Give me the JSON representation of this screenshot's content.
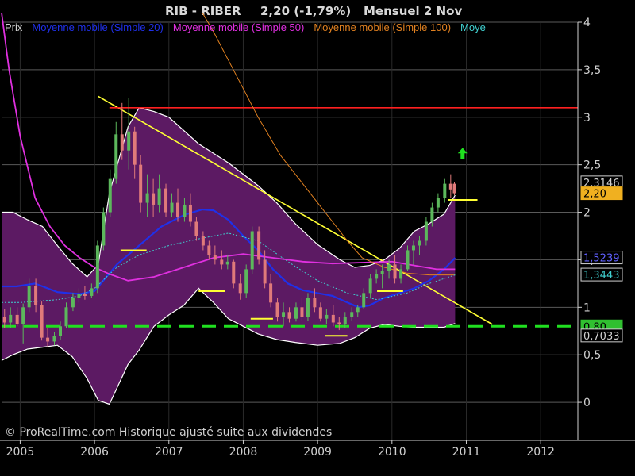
{
  "chart_data": {
    "type": "candlestick",
    "title": {
      "symbol": "RIB - RIBER",
      "change": "2,20 (-1,79%)",
      "period": "Mensuel  2 Nov"
    },
    "legend": [
      {
        "name": "Prix",
        "color": "#d0d0d0"
      },
      {
        "name": "Moyenne mobile (Simple 20)",
        "color": "#2030e8"
      },
      {
        "name": "Moyenne mobile (Simple 50)",
        "color": "#e030e0"
      },
      {
        "name": "Moyenne mobile (Simple 100)",
        "color": "#e08020"
      },
      {
        "name": "Moye",
        "color": "#40d0d0"
      }
    ],
    "footer": "© ProRealTime.com Historique ajusté suite aux dividendes",
    "ylim": [
      -0.4,
      4.0
    ],
    "xlim": [
      2004.75,
      2012.5
    ],
    "y_ticks": [
      {
        "value": 4,
        "label": "4"
      },
      {
        "value": 3.5,
        "label": "3,5"
      },
      {
        "value": 3,
        "label": "3"
      },
      {
        "value": 2.5,
        "label": "2,5"
      },
      {
        "value": 2,
        "label": "2"
      },
      {
        "value": 1.5,
        "label": "1,5"
      },
      {
        "value": 1,
        "label": "1"
      },
      {
        "value": 0.5,
        "label": "0,5"
      },
      {
        "value": 0,
        "label": "0"
      }
    ],
    "x_ticks": [
      {
        "value": 2005,
        "label": "2005"
      },
      {
        "value": 2006,
        "label": "2006"
      },
      {
        "value": 2007,
        "label": "2007"
      },
      {
        "value": 2008,
        "label": "2008"
      },
      {
        "value": 2009,
        "label": "2009"
      },
      {
        "value": 2010,
        "label": "2010"
      },
      {
        "value": 2011,
        "label": "2011"
      },
      {
        "value": 2012,
        "label": "2012"
      }
    ],
    "candles": [
      [
        2004.79,
        0.9,
        0.98,
        0.78,
        0.84
      ],
      [
        2004.87,
        0.84,
        1.0,
        0.78,
        0.92
      ],
      [
        2004.96,
        0.92,
        1.0,
        0.8,
        0.82
      ],
      [
        2005.04,
        0.82,
        1.04,
        0.62,
        1.0
      ],
      [
        2005.12,
        1.0,
        1.3,
        0.95,
        1.22
      ],
      [
        2005.21,
        1.22,
        1.3,
        0.95,
        1.02
      ],
      [
        2005.29,
        1.02,
        1.06,
        0.65,
        0.68
      ],
      [
        2005.37,
        0.68,
        0.78,
        0.58,
        0.64
      ],
      [
        2005.46,
        0.64,
        0.74,
        0.6,
        0.7
      ],
      [
        2005.54,
        0.7,
        0.85,
        0.66,
        0.8
      ],
      [
        2005.62,
        0.8,
        1.05,
        0.78,
        1.0
      ],
      [
        2005.71,
        1.0,
        1.15,
        0.96,
        1.1
      ],
      [
        2005.79,
        1.1,
        1.2,
        1.05,
        1.14
      ],
      [
        2005.87,
        1.14,
        1.22,
        1.08,
        1.12
      ],
      [
        2005.96,
        1.12,
        1.25,
        1.1,
        1.2
      ],
      [
        2006.04,
        1.2,
        1.7,
        1.15,
        1.65
      ],
      [
        2006.12,
        1.65,
        2.05,
        1.6,
        2.0
      ],
      [
        2006.21,
        2.0,
        2.45,
        1.95,
        2.35
      ],
      [
        2006.29,
        2.35,
        2.95,
        2.3,
        2.82
      ],
      [
        2006.37,
        2.82,
        3.15,
        2.55,
        2.65
      ],
      [
        2006.46,
        2.65,
        3.2,
        2.45,
        2.85
      ],
      [
        2006.54,
        2.85,
        2.9,
        2.35,
        2.5
      ],
      [
        2006.62,
        2.5,
        2.6,
        2.0,
        2.1
      ],
      [
        2006.71,
        2.1,
        2.4,
        1.95,
        2.2
      ],
      [
        2006.79,
        2.2,
        2.35,
        1.95,
        2.08
      ],
      [
        2006.87,
        2.08,
        2.4,
        2.0,
        2.25
      ],
      [
        2006.96,
        2.25,
        2.3,
        1.95,
        2.0
      ],
      [
        2007.04,
        2.0,
        2.2,
        1.95,
        2.1
      ],
      [
        2007.12,
        2.1,
        2.25,
        1.9,
        1.95
      ],
      [
        2007.21,
        1.95,
        2.15,
        1.9,
        2.08
      ],
      [
        2007.29,
        2.08,
        2.2,
        1.85,
        1.9
      ],
      [
        2007.37,
        1.9,
        1.95,
        1.7,
        1.75
      ],
      [
        2007.46,
        1.75,
        1.8,
        1.6,
        1.65
      ],
      [
        2007.54,
        1.65,
        1.7,
        1.5,
        1.55
      ],
      [
        2007.62,
        1.55,
        1.65,
        1.45,
        1.5
      ],
      [
        2007.71,
        1.5,
        1.6,
        1.4,
        1.45
      ],
      [
        2007.79,
        1.45,
        1.55,
        1.4,
        1.48
      ],
      [
        2007.87,
        1.48,
        1.5,
        1.2,
        1.25
      ],
      [
        2007.96,
        1.25,
        1.35,
        1.08,
        1.15
      ],
      [
        2008.04,
        1.15,
        1.45,
        1.1,
        1.4
      ],
      [
        2008.12,
        1.4,
        1.85,
        1.35,
        1.8
      ],
      [
        2008.21,
        1.8,
        1.85,
        1.45,
        1.5
      ],
      [
        2008.29,
        1.5,
        1.6,
        1.2,
        1.25
      ],
      [
        2008.37,
        1.25,
        1.35,
        1.0,
        1.05
      ],
      [
        2008.46,
        1.05,
        1.1,
        0.85,
        0.9
      ],
      [
        2008.54,
        0.9,
        1.05,
        0.8,
        0.95
      ],
      [
        2008.62,
        0.95,
        1.0,
        0.84,
        0.88
      ],
      [
        2008.71,
        0.88,
        1.05,
        0.85,
        1.0
      ],
      [
        2008.79,
        1.0,
        1.1,
        0.86,
        0.9
      ],
      [
        2008.87,
        0.9,
        1.15,
        0.86,
        1.1
      ],
      [
        2008.96,
        1.1,
        1.2,
        0.95,
        1.0
      ],
      [
        2009.04,
        1.0,
        1.05,
        0.85,
        0.88
      ],
      [
        2009.12,
        0.88,
        0.98,
        0.82,
        0.92
      ],
      [
        2009.21,
        0.92,
        1.02,
        0.8,
        0.84
      ],
      [
        2009.29,
        0.84,
        0.9,
        0.76,
        0.82
      ],
      [
        2009.37,
        0.82,
        0.95,
        0.78,
        0.9
      ],
      [
        2009.46,
        0.9,
        1.0,
        0.86,
        0.95
      ],
      [
        2009.54,
        0.95,
        1.02,
        0.9,
        1.0
      ],
      [
        2009.62,
        1.0,
        1.2,
        0.98,
        1.15
      ],
      [
        2009.71,
        1.15,
        1.35,
        1.1,
        1.3
      ],
      [
        2009.79,
        1.3,
        1.4,
        1.25,
        1.35
      ],
      [
        2009.87,
        1.35,
        1.45,
        1.2,
        1.38
      ],
      [
        2009.96,
        1.38,
        1.5,
        1.3,
        1.45
      ],
      [
        2010.04,
        1.45,
        1.55,
        1.25,
        1.3
      ],
      [
        2010.12,
        1.3,
        1.45,
        1.25,
        1.4
      ],
      [
        2010.21,
        1.4,
        1.65,
        1.38,
        1.6
      ],
      [
        2010.29,
        1.6,
        1.7,
        1.45,
        1.65
      ],
      [
        2010.37,
        1.65,
        1.75,
        1.55,
        1.7
      ],
      [
        2010.46,
        1.7,
        1.95,
        1.65,
        1.9
      ],
      [
        2010.54,
        1.9,
        2.1,
        1.85,
        2.05
      ],
      [
        2010.62,
        2.05,
        2.2,
        2.0,
        2.15
      ],
      [
        2010.71,
        2.15,
        2.35,
        2.1,
        2.3
      ],
      [
        2010.79,
        2.3,
        2.4,
        2.15,
        2.24
      ],
      [
        2010.84,
        2.3,
        2.32,
        2.18,
        2.2
      ]
    ],
    "series": [
      {
        "name": "Moyenne mobile (Simple 20)",
        "color": "#2030e8",
        "width": 2.2,
        "x": [
          2004.75,
          2004.95,
          2005.2,
          2005.5,
          2005.8,
          2006.0,
          2006.3,
          2006.6,
          2006.9,
          2007.2,
          2007.45,
          2007.6,
          2007.8,
          2008.0,
          2008.2,
          2008.4,
          2008.6,
          2008.8,
          2009.0,
          2009.2,
          2009.4,
          2009.55,
          2009.7,
          2009.9,
          2010.1,
          2010.3,
          2010.5,
          2010.7,
          2010.85
        ],
        "y": [
          1.22,
          1.22,
          1.25,
          1.16,
          1.14,
          1.17,
          1.45,
          1.65,
          1.85,
          1.97,
          2.03,
          2.02,
          1.92,
          1.75,
          1.6,
          1.4,
          1.25,
          1.18,
          1.15,
          1.12,
          1.05,
          1.0,
          1.02,
          1.1,
          1.15,
          1.2,
          1.28,
          1.4,
          1.52
        ]
      },
      {
        "name": "Moyenne mobile (Simple 50)",
        "color": "#e030e0",
        "width": 1.8,
        "x": [
          2004.75,
          2004.85,
          2005.0,
          2005.2,
          2005.4,
          2005.6,
          2005.8,
          2006.0,
          2006.2,
          2006.45,
          2006.8,
          2007.2,
          2007.6,
          2008.0,
          2008.4,
          2008.8,
          2009.2,
          2009.6,
          2010.0,
          2010.3,
          2010.6,
          2010.85
        ],
        "y": [
          4.1,
          3.5,
          2.8,
          2.15,
          1.85,
          1.65,
          1.52,
          1.42,
          1.35,
          1.28,
          1.32,
          1.42,
          1.52,
          1.56,
          1.52,
          1.48,
          1.46,
          1.47,
          1.48,
          1.44,
          1.4,
          1.4
        ]
      },
      {
        "name": "Moyenne mobile (Simple 100)",
        "color": "#e08020",
        "width": 1.0,
        "x": [
          2007.45,
          2007.6,
          2007.8,
          2008.0,
          2008.2,
          2008.5,
          2008.9,
          2009.2,
          2009.4,
          2009.6,
          2009.9,
          2010.2,
          2010.5,
          2010.85
        ],
        "y": [
          4.1,
          3.9,
          3.6,
          3.3,
          3.0,
          2.6,
          2.2,
          1.9,
          1.7,
          1.52,
          1.42,
          1.36,
          1.34,
          1.34
        ]
      },
      {
        "name": "Moye",
        "color": "#40d0d0",
        "width": 1.0,
        "dash": "2,2",
        "x": [
          2004.75,
          2005.0,
          2005.5,
          2005.8,
          2006.0,
          2006.3,
          2006.6,
          2007.0,
          2007.4,
          2007.8,
          2008.2,
          2008.6,
          2009.0,
          2009.4,
          2009.8,
          2010.2,
          2010.5,
          2010.85
        ],
        "y": [
          1.05,
          1.05,
          1.08,
          1.12,
          1.2,
          1.42,
          1.55,
          1.65,
          1.72,
          1.78,
          1.7,
          1.48,
          1.28,
          1.15,
          1.08,
          1.15,
          1.25,
          1.34
        ]
      }
    ],
    "band": {
      "x": [
        2004.75,
        2004.9,
        2005.1,
        2005.3,
        2005.5,
        2005.7,
        2005.9,
        2006.05,
        2006.2,
        2006.45,
        2006.6,
        2006.8,
        2007.0,
        2007.2,
        2007.4,
        2007.6,
        2007.8,
        2008.0,
        2008.2,
        2008.45,
        2008.7,
        2009.0,
        2009.3,
        2009.5,
        2009.7,
        2009.9,
        2010.1,
        2010.3,
        2010.5,
        2010.7,
        2010.85
      ],
      "upper": [
        2.0,
        2.0,
        1.92,
        1.85,
        1.65,
        1.46,
        1.32,
        1.45,
        2.2,
        2.9,
        3.1,
        3.06,
        3.0,
        2.86,
        2.72,
        2.62,
        2.52,
        2.4,
        2.28,
        2.1,
        1.88,
        1.66,
        1.5,
        1.42,
        1.44,
        1.5,
        1.62,
        1.8,
        1.88,
        1.98,
        2.18
      ],
      "lower": [
        0.44,
        0.5,
        0.56,
        0.58,
        0.6,
        0.48,
        0.25,
        0.02,
        -0.02,
        0.4,
        0.55,
        0.8,
        0.92,
        1.02,
        1.2,
        1.05,
        0.88,
        0.8,
        0.72,
        0.66,
        0.63,
        0.6,
        0.62,
        0.68,
        0.78,
        0.82,
        0.8,
        0.79,
        0.79,
        0.79,
        0.83
      ],
      "fill": "#5c1a63",
      "edge": "#ffffff"
    },
    "lines": [
      {
        "kind": "trendline",
        "color": "#ffff33",
        "x": [
          2006.05,
          2011.35
        ],
        "y": [
          3.22,
          0.82
        ]
      },
      {
        "kind": "resistance",
        "color": "#ff2020",
        "x": [
          2006.2,
          2012.5
        ],
        "y": [
          3.1,
          3.1
        ]
      },
      {
        "kind": "support",
        "color": "#20e020",
        "dash": "18,10",
        "x": [
          2004.75,
          2012.5
        ],
        "y": [
          0.8,
          0.8
        ]
      }
    ],
    "markers": [
      {
        "x": [
          2006.35,
          2006.7
        ],
        "y": 1.6
      },
      {
        "x": [
          2007.4,
          2007.75
        ],
        "y": 1.17
      },
      {
        "x": [
          2008.1,
          2008.4
        ],
        "y": 0.88
      },
      {
        "x": [
          2009.1,
          2009.4
        ],
        "y": 0.7
      },
      {
        "x": [
          2009.8,
          2010.15
        ],
        "y": 1.17
      },
      {
        "x": [
          2010.75,
          2011.15
        ],
        "y": 2.13
      }
    ],
    "arrow": {
      "x": 2010.95,
      "y": 2.62,
      "color": "#20e020"
    },
    "price_labels": [
      {
        "value": 2.3146,
        "label": "2,3146",
        "bg": "#000000",
        "fg": "#d0d0d0",
        "border": "#d0d0d0"
      },
      {
        "value": 2.2,
        "label": "2,20",
        "bg": "#f0b020",
        "fg": "#000000",
        "border": "#f0b020"
      },
      {
        "value": 1.5239,
        "label": "1,5239",
        "bg": "#000000",
        "fg": "#6060ff",
        "border": "#d0d0d0"
      },
      {
        "value": 1.3443,
        "label": "1,3443",
        "bg": "#000000",
        "fg": "#40d0d0",
        "border": "#d0d0d0"
      },
      {
        "value": 0.8,
        "label": "0,80",
        "bg": "#30c030",
        "fg": "#000000",
        "border": "#30c030"
      },
      {
        "value": 0.7033,
        "label": "0,7033",
        "bg": "#000000",
        "fg": "#d0d0d0",
        "border": "#d0d0d0"
      }
    ],
    "grid": true,
    "colors": {
      "up": "#5cb85c",
      "down": "#e07a7a",
      "grid": "#5a5a5a",
      "axis": "#d0d0d0"
    }
  }
}
